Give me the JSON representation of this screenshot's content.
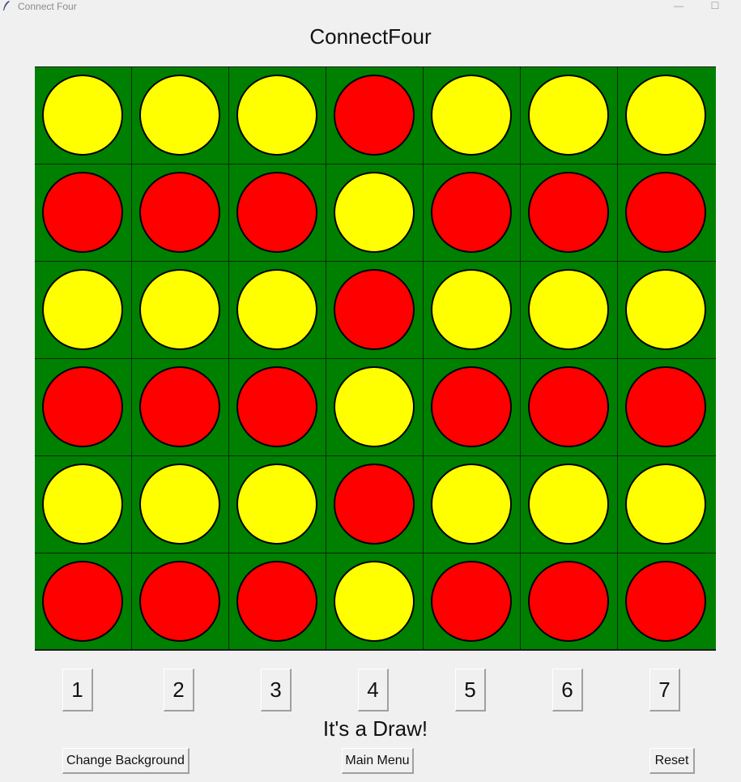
{
  "window": {
    "title": "Connect Four",
    "minimize_glyph": "—",
    "maximize_glyph": "☐"
  },
  "game": {
    "title": "ConnectFour",
    "status": "It's a Draw!",
    "colors": {
      "board": "#008000",
      "red": "#ff0000",
      "yellow": "#ffff00"
    },
    "board": [
      [
        "yellow",
        "yellow",
        "yellow",
        "red",
        "yellow",
        "yellow",
        "yellow"
      ],
      [
        "red",
        "red",
        "red",
        "yellow",
        "red",
        "red",
        "red"
      ],
      [
        "yellow",
        "yellow",
        "yellow",
        "red",
        "yellow",
        "yellow",
        "yellow"
      ],
      [
        "red",
        "red",
        "red",
        "yellow",
        "red",
        "red",
        "red"
      ],
      [
        "yellow",
        "yellow",
        "yellow",
        "red",
        "yellow",
        "yellow",
        "yellow"
      ],
      [
        "red",
        "red",
        "red",
        "yellow",
        "red",
        "red",
        "red"
      ]
    ]
  },
  "columns": [
    "1",
    "2",
    "3",
    "4",
    "5",
    "6",
    "7"
  ],
  "controls": {
    "change_background": "Change Background",
    "main_menu": "Main Menu",
    "reset": "Reset"
  }
}
